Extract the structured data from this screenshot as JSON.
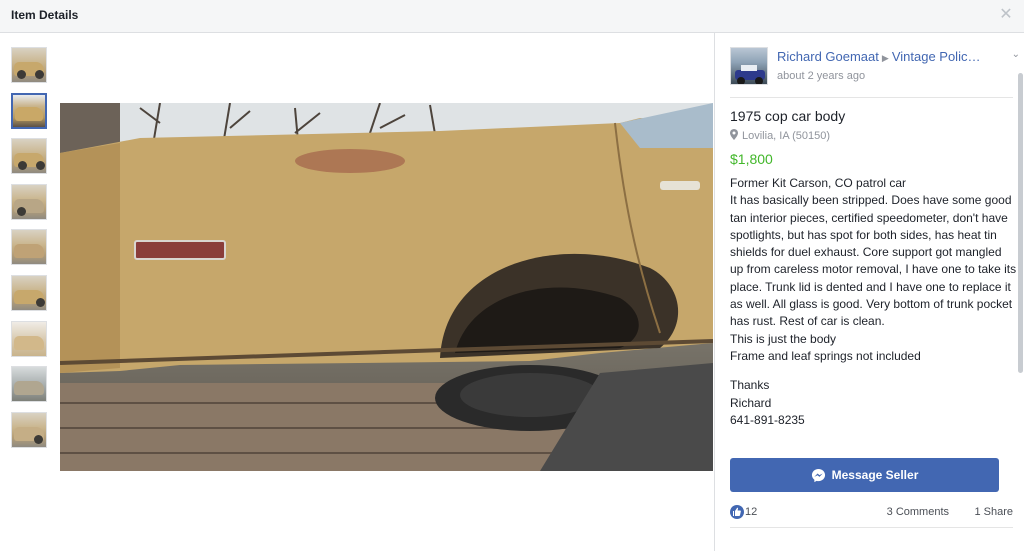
{
  "header": {
    "title": "Item Details",
    "close_icon": "close-icon"
  },
  "thumbnails": {
    "count": 9,
    "active_index": 1
  },
  "seller": {
    "name": "Richard Goemaat",
    "separator": "▶",
    "group": "Vintage Polic…",
    "time": "about 2 years ago"
  },
  "listing": {
    "title": "1975 cop car body",
    "location": "Lovilia, IA (50150)",
    "price": "$1,800",
    "description": [
      "Former Kit Carson, CO patrol car",
      "It has basically been stripped. Does have some good tan interior pieces, certified speedometer, don't have spotlights, but has spot for both sides, has heat tin shields for duel exhaust. Core support got mangled up from careless motor removal, I have one to take its place. Trunk lid is dented and I have one to replace it as well. All glass is good. Very bottom of trunk pocket has rust. Rest of car is clean.",
      "This is just the body",
      "Frame and leaf springs not included"
    ],
    "signoff": [
      "Thanks",
      "Richard",
      "641-891-8235"
    ]
  },
  "actions": {
    "message_label": "Message Seller"
  },
  "engagement": {
    "likes": "12",
    "comments": "3 Comments",
    "shares": "1 Share"
  },
  "colors": {
    "accent": "#4267b2",
    "price": "#42b72a",
    "muted": "#90949c"
  }
}
